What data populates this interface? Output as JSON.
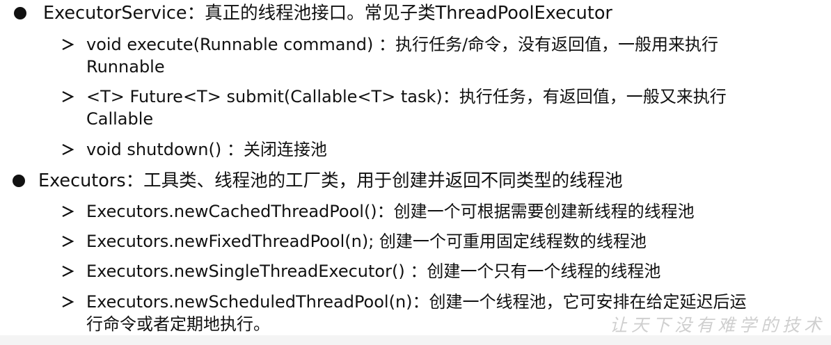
{
  "sections": [
    {
      "heading": "ExecutorService：真正的线程池接口。常见子类ThreadPoolExecutor",
      "items": [
        {
          "line1": "void execute(Runnable command) ：执行任务/命令，没有返回值，一般用来执行",
          "line2": "Runnable"
        },
        {
          "line1": "<T> Future<T> submit(Callable<T> task)：执行任务，有返回值，一般又来执行",
          "line2": "Callable"
        },
        {
          "line1": "void shutdown() ：关闭连接池"
        }
      ]
    },
    {
      "heading": "Executors：工具类、线程池的工厂类，用于创建并返回不同类型的线程池",
      "items": [
        {
          "line1": "Executors.newCachedThreadPool()：创建一个可根据需要创建新线程的线程池"
        },
        {
          "line1": "Executors.newFixedThreadPool(n); 创建一个可重用固定线程数的线程池"
        },
        {
          "line1": "Executors.newSingleThreadExecutor() ：创建一个只有一个线程的线程池"
        },
        {
          "line1": "Executors.newScheduledThreadPool(n)：创建一个线程池，它可安排在给定延迟后运",
          "line2": "行命令或者定期地执行。"
        }
      ]
    }
  ],
  "watermark": "让天下没有难学的技术"
}
